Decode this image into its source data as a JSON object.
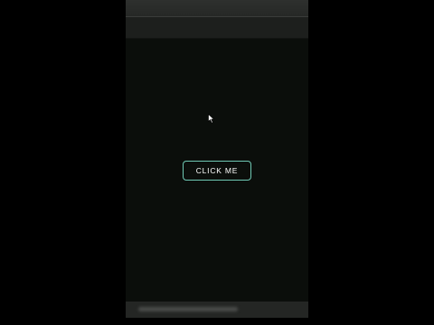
{
  "main": {
    "button_label": "CLICK ME"
  },
  "colors": {
    "background": "#0b0e0b",
    "button_border": "#6fc8b4",
    "button_text": "#ffffff"
  },
  "icons": {
    "cursor": "mouse-pointer-icon"
  }
}
